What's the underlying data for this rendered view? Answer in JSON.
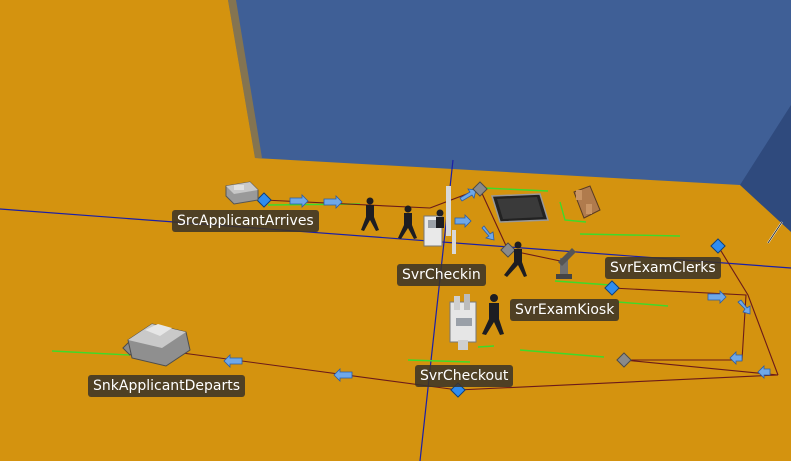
{
  "scene": {
    "colors": {
      "floor": "#d4930f",
      "wall": "#3f5f96",
      "wall_side": "#2f4a7d",
      "grid_line": "#1b1fa8",
      "path_line": "#6b1a1a",
      "conveyor_green": "#3ddb2a",
      "node_blue": "#2f8df0",
      "node_gray": "#8a8a8a",
      "label_bg": "#3c3428",
      "label_text": "#ffffff"
    },
    "objects": {
      "src": {
        "label": "SrcApplicantArrives",
        "icon": "source-block"
      },
      "checkin": {
        "label": "SvrCheckin",
        "icon": "checkin-station"
      },
      "exam_clerks": {
        "label": "SvrExamClerks",
        "icon": "exam-desk"
      },
      "exam_kiosk": {
        "label": "SvrExamKiosk",
        "icon": "kiosk"
      },
      "checkout": {
        "label": "SvrCheckout",
        "icon": "checkout-station"
      },
      "sink": {
        "label": "SnkApplicantDeparts",
        "icon": "sink-block"
      }
    }
  }
}
